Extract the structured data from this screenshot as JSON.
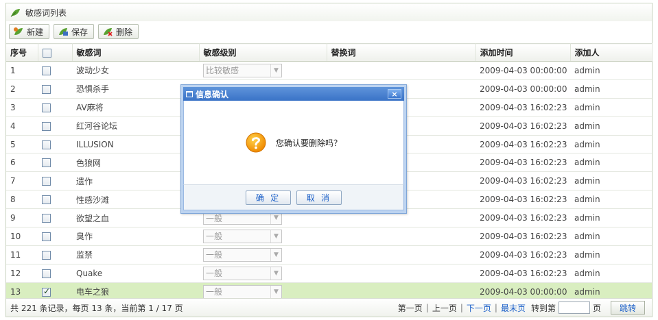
{
  "panel": {
    "title": "敏感词列表"
  },
  "toolbar": {
    "new_label": "新建",
    "save_label": "保存",
    "delete_label": "删除"
  },
  "columns": [
    "序号",
    "",
    "敏感词",
    "敏感级别",
    "替换词",
    "添加时间",
    "添加人"
  ],
  "rows": [
    {
      "idx": "1",
      "checked": false,
      "word": "波动少女",
      "level": "比较敏感",
      "replace": "",
      "time": "2009-04-03 00:00:00",
      "user": "admin"
    },
    {
      "idx": "2",
      "checked": false,
      "word": "恐惧杀手",
      "level": "",
      "replace": "",
      "time": "2009-04-03 00:00:00",
      "user": "admin"
    },
    {
      "idx": "3",
      "checked": false,
      "word": "AV麻将",
      "level": "",
      "replace": "",
      "time": "2009-04-03 16:02:23",
      "user": "admin"
    },
    {
      "idx": "4",
      "checked": false,
      "word": "红河谷论坛",
      "level": "",
      "replace": "",
      "time": "2009-04-03 16:02:23",
      "user": "admin"
    },
    {
      "idx": "5",
      "checked": false,
      "word": "ILLUSION",
      "level": "",
      "replace": "",
      "time": "2009-04-03 16:02:23",
      "user": "admin"
    },
    {
      "idx": "6",
      "checked": false,
      "word": "色狼网",
      "level": "",
      "replace": "",
      "time": "2009-04-03 16:02:23",
      "user": "admin"
    },
    {
      "idx": "7",
      "checked": false,
      "word": "遗作",
      "level": "",
      "replace": "",
      "time": "2009-04-03 16:02:23",
      "user": "admin"
    },
    {
      "idx": "8",
      "checked": false,
      "word": "性感沙滩",
      "level": "",
      "replace": "",
      "time": "2009-04-03 16:02:23",
      "user": "admin"
    },
    {
      "idx": "9",
      "checked": false,
      "word": "欲望之血",
      "level": "一般",
      "replace": "",
      "time": "2009-04-03 16:02:23",
      "user": "admin"
    },
    {
      "idx": "10",
      "checked": false,
      "word": "臭作",
      "level": "一般",
      "replace": "",
      "time": "2009-04-03 16:02:23",
      "user": "admin"
    },
    {
      "idx": "11",
      "checked": false,
      "word": "监禁",
      "level": "一般",
      "replace": "",
      "time": "2009-04-03 16:02:23",
      "user": "admin"
    },
    {
      "idx": "12",
      "checked": false,
      "word": "Quake",
      "level": "一般",
      "replace": "",
      "time": "2009-04-03 16:02:23",
      "user": "admin"
    },
    {
      "idx": "13",
      "checked": true,
      "word": "电车之狼",
      "level": "一般",
      "replace": "",
      "time": "2009-04-03 00:00:00",
      "user": "admin"
    }
  ],
  "footer": {
    "summary": "共 221 条记录，每页 13 条，当前第 1 / 17 页",
    "first": "第一页",
    "prev": "上一页",
    "next": "下一页",
    "last": "最末页",
    "goto_label": "转到第",
    "page_unit": "页",
    "jump_label": "跳转",
    "sep": "|"
  },
  "dialog": {
    "title": "信息确认",
    "close_glyph": "×",
    "message": "您确认要删除吗？",
    "ok_label": "确 定",
    "cancel_label": "取 消"
  },
  "colors": {
    "selected_row": "#d9eec0",
    "dialog_title": "#3a73c7",
    "link": "#1a5fc8"
  }
}
